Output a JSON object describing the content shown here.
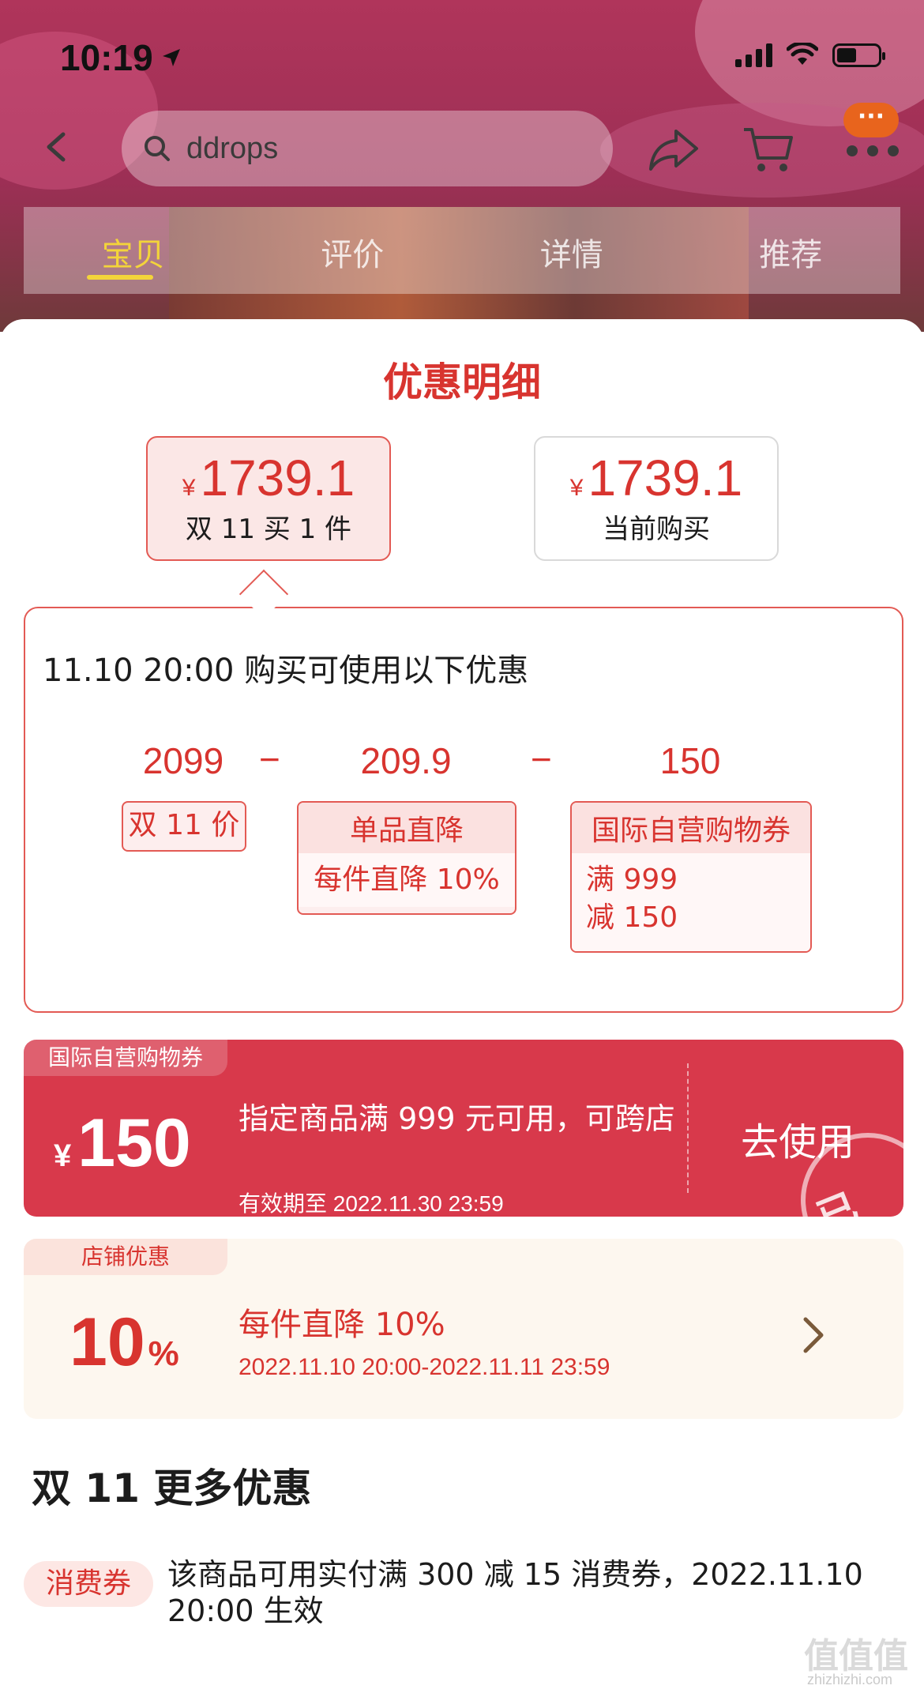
{
  "status_bar": {
    "time": "10:19"
  },
  "search": {
    "query": "ddrops"
  },
  "tabs": [
    {
      "label": "宝贝"
    },
    {
      "label": "评价"
    },
    {
      "label": "详情"
    },
    {
      "label": "推荐"
    }
  ],
  "more_badge": "···",
  "sheet": {
    "title": "优惠明细",
    "price_options": [
      {
        "currency": "¥",
        "amount": "1739.1",
        "label": "双 11 买 1 件",
        "selected": true
      },
      {
        "currency": "¥",
        "amount": "1739.1",
        "label": "当前购买",
        "selected": false
      }
    ],
    "detail": {
      "heading": "11.10 20:00 购买可使用以下优惠",
      "operator": "−",
      "items": [
        {
          "value": "2099",
          "head": "双 11 价",
          "body": []
        },
        {
          "value": "209.9",
          "head": "单品直降",
          "body": [
            "每件直降 10%"
          ]
        },
        {
          "value": "150",
          "head": "国际自营购物券",
          "body": [
            "满 999",
            "减 150"
          ]
        }
      ]
    },
    "coupon": {
      "tag": "国际自营购物券",
      "currency": "¥",
      "amount": "150",
      "description": "指定商品满 999 元可用，可跨店",
      "validity": "有效期至 2022.11.30 23:59",
      "action": "去使用",
      "stamp": "已领"
    },
    "shop_discount": {
      "tag": "店铺优惠",
      "value": "10",
      "unit": "%",
      "title": "每件直降 10%",
      "period": "2022.11.10 20:00-2022.11.11 23:59"
    },
    "more_section": {
      "title": "双 11 更多优惠",
      "voucher_tag": "消费券",
      "voucher_desc": "该商品可用实付满 300 减 15 消费券，2022.11.10 20:00 生效"
    }
  },
  "watermark": {
    "main": "值值值",
    "sub": "zhizhizhi.com"
  },
  "colors": {
    "accent_red": "#d8342f",
    "coupon_red": "#d8394b",
    "tab_active": "#f3d43a"
  }
}
